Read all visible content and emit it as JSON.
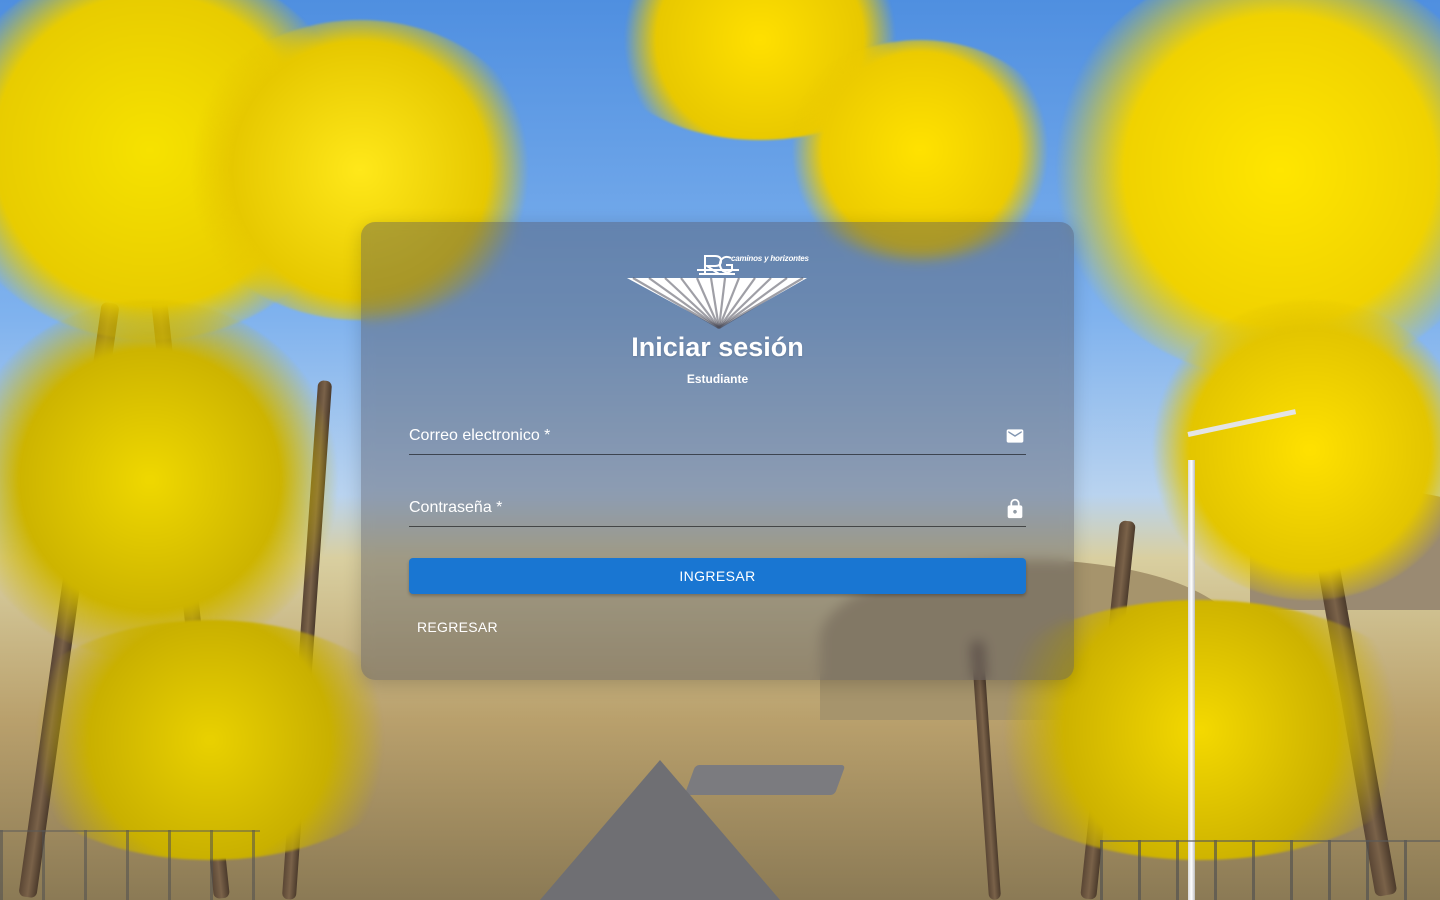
{
  "logo": {
    "tagline": "caminos y horizontes",
    "icon": "sunburst-logo-icon"
  },
  "login": {
    "title": "Iniciar sesión",
    "subtitle": "Estudiante",
    "email_label": "Correo electronico *",
    "email_value": "",
    "email_icon": "mail-icon",
    "password_label": "Contraseña *",
    "password_value": "",
    "password_icon": "lock-icon",
    "submit_label": "INGRESAR",
    "back_label": "REGRESAR"
  },
  "colors": {
    "primary": "#1976d2",
    "card_overlay": "rgba(80, 80, 92, 0.42)",
    "text": "#ffffff"
  }
}
